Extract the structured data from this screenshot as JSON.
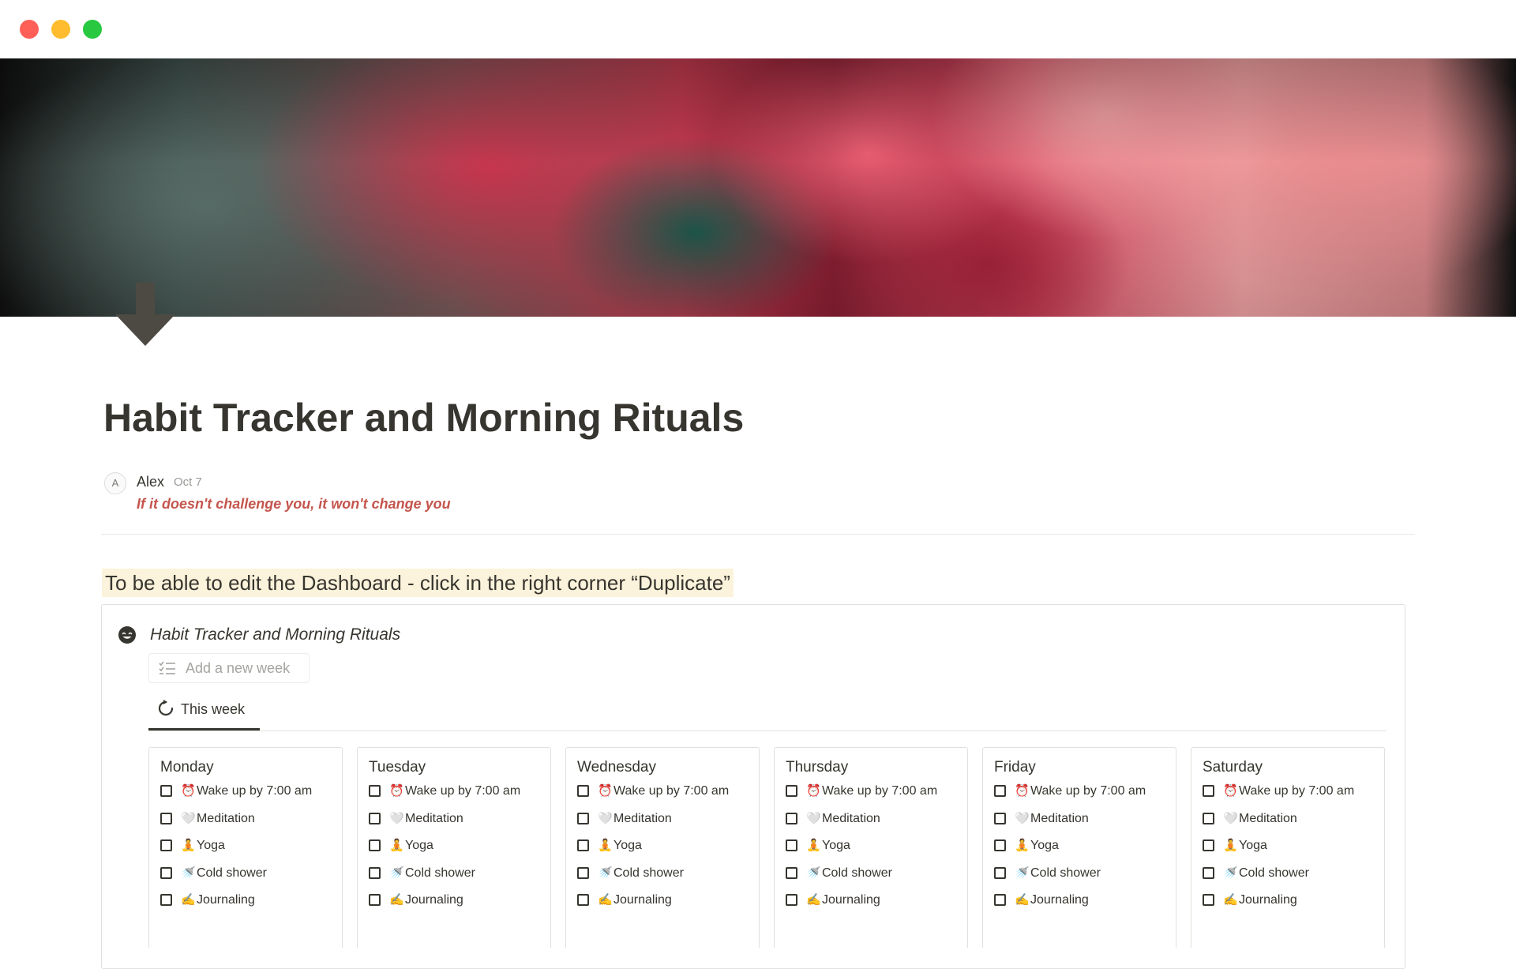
{
  "window": {
    "controls": [
      "close",
      "minimize",
      "zoom"
    ]
  },
  "page": {
    "title": "Habit Tracker and Morning Rituals",
    "icon": "down-arrow-icon",
    "author": {
      "initial": "A",
      "name": "Alex",
      "date": "Oct 7"
    },
    "quote": "If it doesn't challenge you, it won't change you",
    "notice": "To be able to edit the Dashboard - click in the right corner “Duplicate”"
  },
  "widget": {
    "icon": "smiling-face-icon",
    "title": "Habit Tracker and Morning Rituals",
    "add_week_label": "Add a new week",
    "tab_label": "This week",
    "days": [
      {
        "name": "Monday",
        "habits": [
          {
            "emoji": "⏰",
            "label": "Wake up by 7:00 am"
          },
          {
            "emoji": "🤍",
            "label": "Meditation"
          },
          {
            "emoji": "🧘",
            "label": "Yoga"
          },
          {
            "emoji": "🚿",
            "label": "Cold shower"
          },
          {
            "emoji": "✍️",
            "label": "Journaling"
          }
        ]
      },
      {
        "name": "Tuesday",
        "habits": [
          {
            "emoji": "⏰",
            "label": "Wake up by 7:00 am"
          },
          {
            "emoji": "🤍",
            "label": "Meditation"
          },
          {
            "emoji": "🧘",
            "label": "Yoga"
          },
          {
            "emoji": "🚿",
            "label": "Cold shower"
          },
          {
            "emoji": "✍️",
            "label": "Journaling"
          }
        ]
      },
      {
        "name": "Wednesday",
        "habits": [
          {
            "emoji": "⏰",
            "label": "Wake up by 7:00 am"
          },
          {
            "emoji": "🤍",
            "label": "Meditation"
          },
          {
            "emoji": "🧘",
            "label": "Yoga"
          },
          {
            "emoji": "🚿",
            "label": "Cold shower"
          },
          {
            "emoji": "✍️",
            "label": "Journaling"
          }
        ]
      },
      {
        "name": "Thursday",
        "habits": [
          {
            "emoji": "⏰",
            "label": "Wake up by 7:00 am"
          },
          {
            "emoji": "🤍",
            "label": "Meditation"
          },
          {
            "emoji": "🧘",
            "label": "Yoga"
          },
          {
            "emoji": "🚿",
            "label": "Cold shower"
          },
          {
            "emoji": "✍️",
            "label": "Journaling"
          }
        ]
      },
      {
        "name": "Friday",
        "habits": [
          {
            "emoji": "⏰",
            "label": "Wake up by 7:00 am"
          },
          {
            "emoji": "🤍",
            "label": "Meditation"
          },
          {
            "emoji": "🧘",
            "label": "Yoga"
          },
          {
            "emoji": "🚿",
            "label": "Cold shower"
          },
          {
            "emoji": "✍️",
            "label": "Journaling"
          }
        ]
      },
      {
        "name": "Saturday",
        "habits": [
          {
            "emoji": "⏰",
            "label": "Wake up by 7:00 am"
          },
          {
            "emoji": "🤍",
            "label": "Meditation"
          },
          {
            "emoji": "🧘",
            "label": "Yoga"
          },
          {
            "emoji": "🚿",
            "label": "Cold shower"
          },
          {
            "emoji": "✍️",
            "label": "Journaling"
          }
        ]
      }
    ]
  },
  "colors": {
    "text": "#37352f",
    "quote": "#c4554d",
    "highlight_bg": "#fbf3db",
    "muted": "#9b9a97",
    "border": "#e1e0dc",
    "close": "#fe5f57",
    "minimize": "#febc2e",
    "zoom": "#28c840"
  }
}
